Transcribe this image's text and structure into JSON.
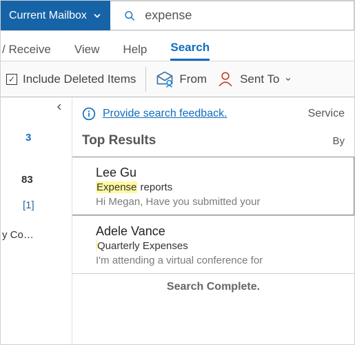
{
  "scope": {
    "label": "Current Mailbox"
  },
  "search": {
    "query": "expense"
  },
  "tabs": {
    "receive": "/ Receive",
    "view": "View",
    "help": "Help",
    "search": "Search"
  },
  "ribbon": {
    "include_deleted": "Include Deleted Items",
    "include_deleted_checked": "✓",
    "from": "From",
    "sent_to": "Sent To"
  },
  "nav": {
    "count_a": "3",
    "count_b": "83",
    "count_c": "[1]",
    "folder_trunc": "y Co…"
  },
  "feedback": {
    "text": "Provide search feedback.",
    "right_clip": "Service"
  },
  "section": {
    "title": "Top Results",
    "right_clip": "By"
  },
  "results": [
    {
      "from": "Lee Gu",
      "subject_hl": "Expense",
      "subject_rest": " reports",
      "preview": "Hi Megan,  Have you submitted your"
    },
    {
      "from": "Adele Vance",
      "subject_hl": "",
      "subject_rest": "Quarterly Expenses",
      "preview": "I'm attending a virtual conference for"
    }
  ],
  "status": "Search Complete."
}
